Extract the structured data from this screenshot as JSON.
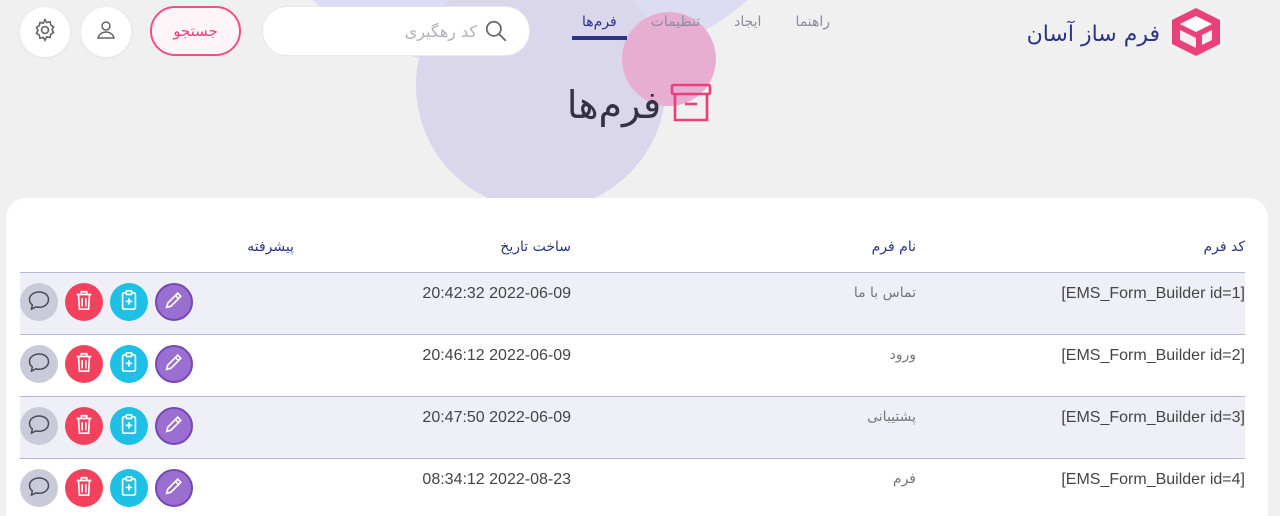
{
  "brand": {
    "name": "فرم ساز آسان",
    "accent": "#e8407a"
  },
  "nav": [
    {
      "label": "فرم‌ها",
      "active": true
    },
    {
      "label": "تنظیمات",
      "active": false
    },
    {
      "label": "ایجاد",
      "active": false
    },
    {
      "label": "راهنما",
      "active": false
    }
  ],
  "search": {
    "placeholder": "کد رهگیری",
    "button_label": "جستجو"
  },
  "page": {
    "title": "فرم‌ها"
  },
  "table": {
    "headers": {
      "code": "کد فرم",
      "name": "نام فرم",
      "date": "ساخت تاریخ",
      "advanced": "پیشرفته"
    },
    "rows": [
      {
        "code": "[EMS_Form_Builder id=1]",
        "name": "تماس با ما",
        "date": "2022-06-09 20:42:32"
      },
      {
        "code": "[EMS_Form_Builder id=2]",
        "name": "ورود",
        "date": "2022-06-09 20:46:12"
      },
      {
        "code": "[EMS_Form_Builder id=3]",
        "name": "پشتیبانی",
        "date": "2022-06-09 20:47:50"
      },
      {
        "code": "[EMS_Form_Builder id=4]",
        "name": "فرم",
        "date": "2022-08-23 08:34:12"
      }
    ]
  },
  "icons": [
    "settings-icon",
    "user-icon",
    "search-icon",
    "archive-icon",
    "edit-icon",
    "clipboard-icon",
    "trash-icon",
    "comment-icon"
  ]
}
